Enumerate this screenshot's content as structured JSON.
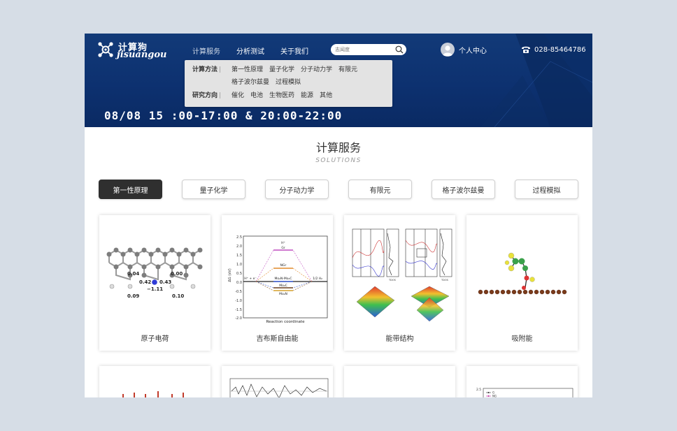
{
  "brand": {
    "name_cn": "计算狗",
    "name_en": "jisuangou"
  },
  "nav": {
    "items": [
      "计算服务",
      "分析测试",
      "关于我们"
    ]
  },
  "search": {
    "placeholder": "志闻度"
  },
  "user": {
    "label": "个人中心"
  },
  "phone": {
    "number": "028-85464786"
  },
  "dropdown": {
    "methods_label": "计算方法",
    "methods": [
      "第一性原理",
      "量子化学",
      "分子动力学",
      "有限元",
      "格子波尔兹曼",
      "过程模拟"
    ],
    "fields_label": "研究方向",
    "fields": [
      "催化",
      "电池",
      "生物医药",
      "能源",
      "其他"
    ],
    "separator": "|"
  },
  "hero": {
    "schedule": "08/08 15 :00-17:00 & 20:00-22:00"
  },
  "section": {
    "title": "计算服务",
    "subtitle": "SOLUTIONS"
  },
  "tabs": [
    "第一性原理",
    "量子化学",
    "分子动力学",
    "有限元",
    "格子波尔兹曼",
    "过程模拟"
  ],
  "active_tab": "第一性原理",
  "cards": [
    "原子电荷",
    "吉布斯自由能",
    "能带结构",
    "吸附能"
  ],
  "figures": {
    "charge": {
      "labels": [
        "0.04",
        "0.00",
        "0.42",
        "0.43",
        "−1.11",
        "0.09",
        "0.10"
      ]
    },
    "gibbs": {
      "y_ticks": [
        "2.5",
        "2.0",
        "1.5",
        "1.0",
        "0.5",
        "0.0",
        "-0.5",
        "-1.0",
        "-1.5",
        "-2.0"
      ],
      "y_label": "ΔG (eV)",
      "x_label": "Reaction coordinate",
      "levels": [
        "H⁺",
        "Gr",
        "NGr",
        "Mo₂N-Mo₂C",
        "Mo₂C",
        "Mo₂N"
      ],
      "left_label": "H⁺ + e⁻",
      "right_label": "1/2 H₂"
    },
    "band": {
      "tdos_label": "TDOS"
    },
    "bottom_legend": {
      "tick": "2.5",
      "items": [
        "G",
        "NG"
      ]
    }
  },
  "colors": {
    "hero_bg": "#0d3170",
    "tab_active": "#2f2f2f",
    "page_bg": "#d6dde6"
  }
}
